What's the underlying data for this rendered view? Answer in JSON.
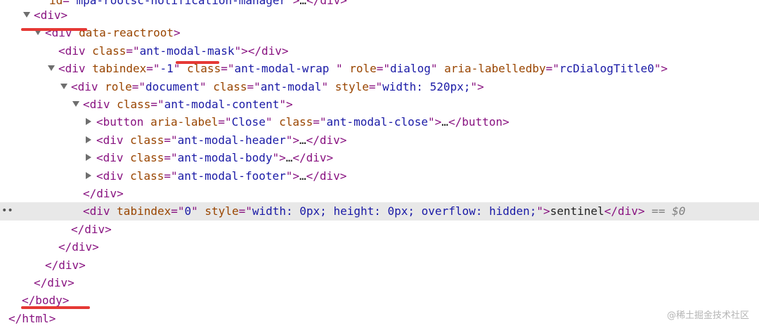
{
  "tree": {
    "lines": [
      {
        "indent": 70,
        "arrow": "none",
        "partial": true,
        "segments": [
          {
            "c": "attr",
            "t": "id"
          },
          {
            "c": "tag",
            "t": "=\""
          },
          {
            "c": "val",
            "t": "mpa-rootsc-notification-manager"
          },
          {
            "c": "tag",
            "t": "\">"
          },
          {
            "c": "txt",
            "t": "…"
          },
          {
            "c": "tag",
            "t": "</div>"
          }
        ]
      },
      {
        "indent": 48,
        "arrow": "down",
        "segments": [
          {
            "c": "tag",
            "t": "<div>"
          }
        ]
      },
      {
        "indent": 64,
        "arrow": "down",
        "segments": [
          {
            "c": "tag",
            "t": "<div "
          },
          {
            "c": "attr",
            "t": "data-reactroot"
          },
          {
            "c": "tag",
            "t": ">"
          }
        ]
      },
      {
        "indent": 83,
        "arrow": "none",
        "segments": [
          {
            "c": "tag",
            "t": "<div "
          },
          {
            "c": "attr",
            "t": "class"
          },
          {
            "c": "tag",
            "t": "=\""
          },
          {
            "c": "val",
            "t": "ant-modal-mask"
          },
          {
            "c": "tag",
            "t": "\">"
          },
          {
            "c": "tag",
            "t": "</div>"
          }
        ]
      },
      {
        "indent": 83,
        "arrow": "down",
        "segments": [
          {
            "c": "tag",
            "t": "<div "
          },
          {
            "c": "attr",
            "t": "tabindex"
          },
          {
            "c": "tag",
            "t": "=\""
          },
          {
            "c": "val",
            "t": "-1"
          },
          {
            "c": "tag",
            "t": "\" "
          },
          {
            "c": "attr",
            "t": "class"
          },
          {
            "c": "tag",
            "t": "=\""
          },
          {
            "c": "val",
            "t": "ant-modal-wrap "
          },
          {
            "c": "tag",
            "t": "\" "
          },
          {
            "c": "attr",
            "t": "role"
          },
          {
            "c": "tag",
            "t": "=\""
          },
          {
            "c": "val",
            "t": "dialog"
          },
          {
            "c": "tag",
            "t": "\" "
          },
          {
            "c": "attr",
            "t": "aria-labelledby"
          },
          {
            "c": "tag",
            "t": "=\""
          },
          {
            "c": "val",
            "t": "rcDialogTitle0"
          },
          {
            "c": "tag",
            "t": "\">"
          }
        ]
      },
      {
        "indent": 101,
        "arrow": "down",
        "segments": [
          {
            "c": "tag",
            "t": "<div "
          },
          {
            "c": "attr",
            "t": "role"
          },
          {
            "c": "tag",
            "t": "=\""
          },
          {
            "c": "val",
            "t": "document"
          },
          {
            "c": "tag",
            "t": "\" "
          },
          {
            "c": "attr",
            "t": "class"
          },
          {
            "c": "tag",
            "t": "=\""
          },
          {
            "c": "val",
            "t": "ant-modal"
          },
          {
            "c": "tag",
            "t": "\" "
          },
          {
            "c": "attr",
            "t": "style"
          },
          {
            "c": "tag",
            "t": "=\""
          },
          {
            "c": "val",
            "t": "width: 520px;"
          },
          {
            "c": "tag",
            "t": "\">"
          }
        ]
      },
      {
        "indent": 118,
        "arrow": "down",
        "segments": [
          {
            "c": "tag",
            "t": "<div "
          },
          {
            "c": "attr",
            "t": "class"
          },
          {
            "c": "tag",
            "t": "=\""
          },
          {
            "c": "val",
            "t": "ant-modal-content"
          },
          {
            "c": "tag",
            "t": "\">"
          }
        ]
      },
      {
        "indent": 137,
        "arrow": "right",
        "segments": [
          {
            "c": "tag",
            "t": "<button "
          },
          {
            "c": "attr",
            "t": "aria-label"
          },
          {
            "c": "tag",
            "t": "=\""
          },
          {
            "c": "val",
            "t": "Close"
          },
          {
            "c": "tag",
            "t": "\" "
          },
          {
            "c": "attr",
            "t": "class"
          },
          {
            "c": "tag",
            "t": "=\""
          },
          {
            "c": "val",
            "t": "ant-modal-close"
          },
          {
            "c": "tag",
            "t": "\">"
          },
          {
            "c": "txt",
            "t": "…"
          },
          {
            "c": "tag",
            "t": "</button>"
          }
        ]
      },
      {
        "indent": 137,
        "arrow": "right",
        "segments": [
          {
            "c": "tag",
            "t": "<div "
          },
          {
            "c": "attr",
            "t": "class"
          },
          {
            "c": "tag",
            "t": "=\""
          },
          {
            "c": "val",
            "t": "ant-modal-header"
          },
          {
            "c": "tag",
            "t": "\">"
          },
          {
            "c": "txt",
            "t": "…"
          },
          {
            "c": "tag",
            "t": "</div>"
          }
        ]
      },
      {
        "indent": 137,
        "arrow": "right",
        "segments": [
          {
            "c": "tag",
            "t": "<div "
          },
          {
            "c": "attr",
            "t": "class"
          },
          {
            "c": "tag",
            "t": "=\""
          },
          {
            "c": "val",
            "t": "ant-modal-body"
          },
          {
            "c": "tag",
            "t": "\">"
          },
          {
            "c": "txt",
            "t": "…"
          },
          {
            "c": "tag",
            "t": "</div>"
          }
        ]
      },
      {
        "indent": 137,
        "arrow": "right",
        "segments": [
          {
            "c": "tag",
            "t": "<div "
          },
          {
            "c": "attr",
            "t": "class"
          },
          {
            "c": "tag",
            "t": "=\""
          },
          {
            "c": "val",
            "t": "ant-modal-footer"
          },
          {
            "c": "tag",
            "t": "\">"
          },
          {
            "c": "txt",
            "t": "…"
          },
          {
            "c": "tag",
            "t": "</div>"
          }
        ]
      },
      {
        "indent": 118,
        "arrow": "none",
        "segments": [
          {
            "c": "tag",
            "t": "</div>"
          }
        ]
      },
      {
        "indent": 118,
        "arrow": "none",
        "selected": true,
        "segments": [
          {
            "c": "tag",
            "t": "<div "
          },
          {
            "c": "attr",
            "t": "tabindex"
          },
          {
            "c": "tag",
            "t": "=\""
          },
          {
            "c": "val",
            "t": "0"
          },
          {
            "c": "tag",
            "t": "\" "
          },
          {
            "c": "attr",
            "t": "style"
          },
          {
            "c": "tag",
            "t": "=\""
          },
          {
            "c": "val",
            "t": "width: 0px; height: 0px; overflow: hidden;"
          },
          {
            "c": "tag",
            "t": "\">"
          },
          {
            "c": "txt",
            "t": "sentinel"
          },
          {
            "c": "tag",
            "t": "</div>"
          },
          {
            "c": "dim",
            "t": " == $0"
          }
        ]
      },
      {
        "indent": 101,
        "arrow": "none",
        "segments": [
          {
            "c": "tag",
            "t": "</div>"
          }
        ]
      },
      {
        "indent": 83,
        "arrow": "none",
        "segments": [
          {
            "c": "tag",
            "t": "</div>"
          }
        ]
      },
      {
        "indent": 64,
        "arrow": "none",
        "segments": [
          {
            "c": "tag",
            "t": "</div>"
          }
        ]
      },
      {
        "indent": 48,
        "arrow": "none",
        "segments": [
          {
            "c": "tag",
            "t": "</div>"
          }
        ]
      },
      {
        "indent": 31,
        "arrow": "none",
        "segments": [
          {
            "c": "tag",
            "t": "</body>"
          }
        ]
      },
      {
        "indent": 12,
        "arrow": "none",
        "segments": [
          {
            "c": "tag",
            "t": "</html>"
          }
        ]
      }
    ],
    "gutter_marker": "••"
  },
  "annotation_color": "#e53935",
  "watermark": "@稀土掘金技术社区"
}
